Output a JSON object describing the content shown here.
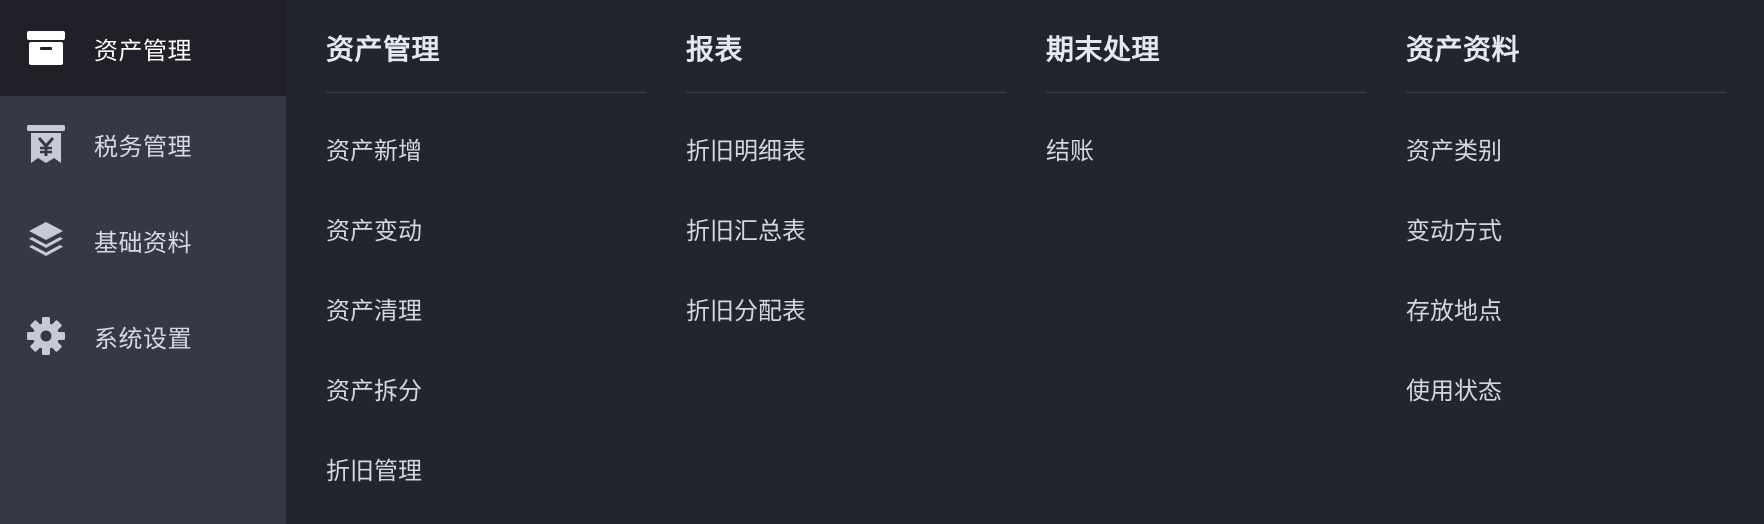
{
  "sidebar": {
    "items": [
      {
        "label": "资产管理",
        "icon": "archive-box-icon",
        "active": true
      },
      {
        "label": "税务管理",
        "icon": "tax-receipt-icon",
        "active": false
      },
      {
        "label": "基础资料",
        "icon": "layers-icon",
        "active": false
      },
      {
        "label": "系统设置",
        "icon": "gear-icon",
        "active": false
      }
    ]
  },
  "menu": {
    "columns": [
      {
        "title": "资产管理",
        "items": [
          "资产新增",
          "资产变动",
          "资产清理",
          "资产拆分",
          "折旧管理"
        ]
      },
      {
        "title": "报表",
        "items": [
          "折旧明细表",
          "折旧汇总表",
          "折旧分配表"
        ]
      },
      {
        "title": "期末处理",
        "items": [
          "结账"
        ]
      },
      {
        "title": "资产资料",
        "items": [
          "资产类别",
          "变动方式",
          "存放地点",
          "使用状态"
        ]
      }
    ]
  },
  "colors": {
    "sidebar_bg": "#363848",
    "sidebar_active_bg": "#202128",
    "panel_bg": "#22242e",
    "text": "#d4d7e1",
    "title": "#e6e8ef",
    "rule": "#3d404c"
  }
}
